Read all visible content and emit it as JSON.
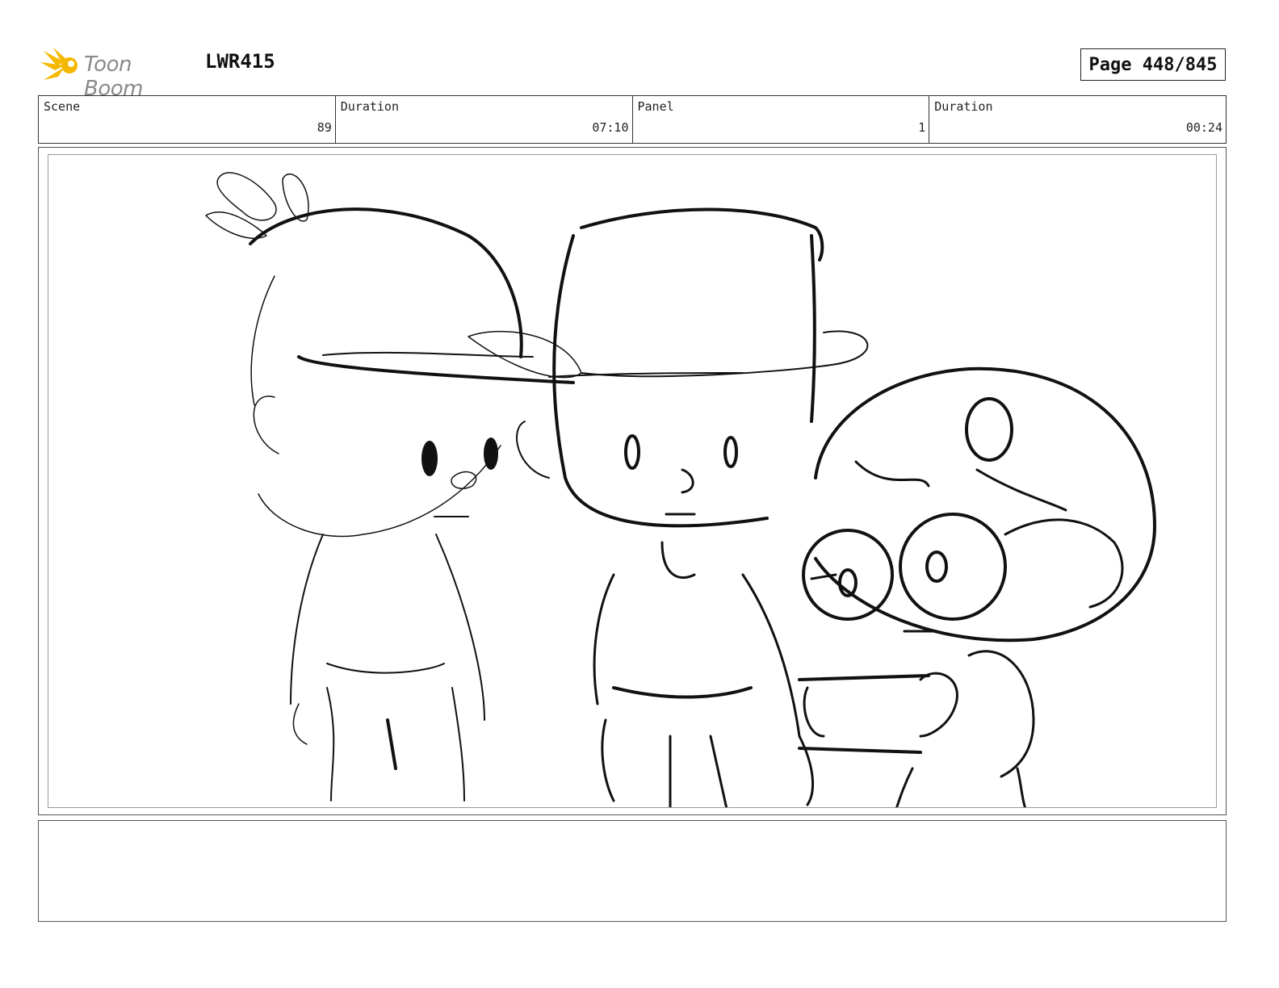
{
  "header": {
    "logo_text": "Toon Boom",
    "project_id": "LWR415",
    "page_indicator": "Page 448/845"
  },
  "info_bar": [
    {
      "label": "Scene",
      "value": "89"
    },
    {
      "label": "Duration",
      "value": "07:10"
    },
    {
      "label": "Panel",
      "value": "1"
    },
    {
      "label": "Duration",
      "value": "00:24"
    }
  ],
  "panel": {
    "icon": "storyboard-sketch-image"
  },
  "notes": {
    "text": ""
  },
  "colors": {
    "logo_accent": "#F5B800",
    "logo_text": "#8a8a8a",
    "border": "#333333"
  }
}
